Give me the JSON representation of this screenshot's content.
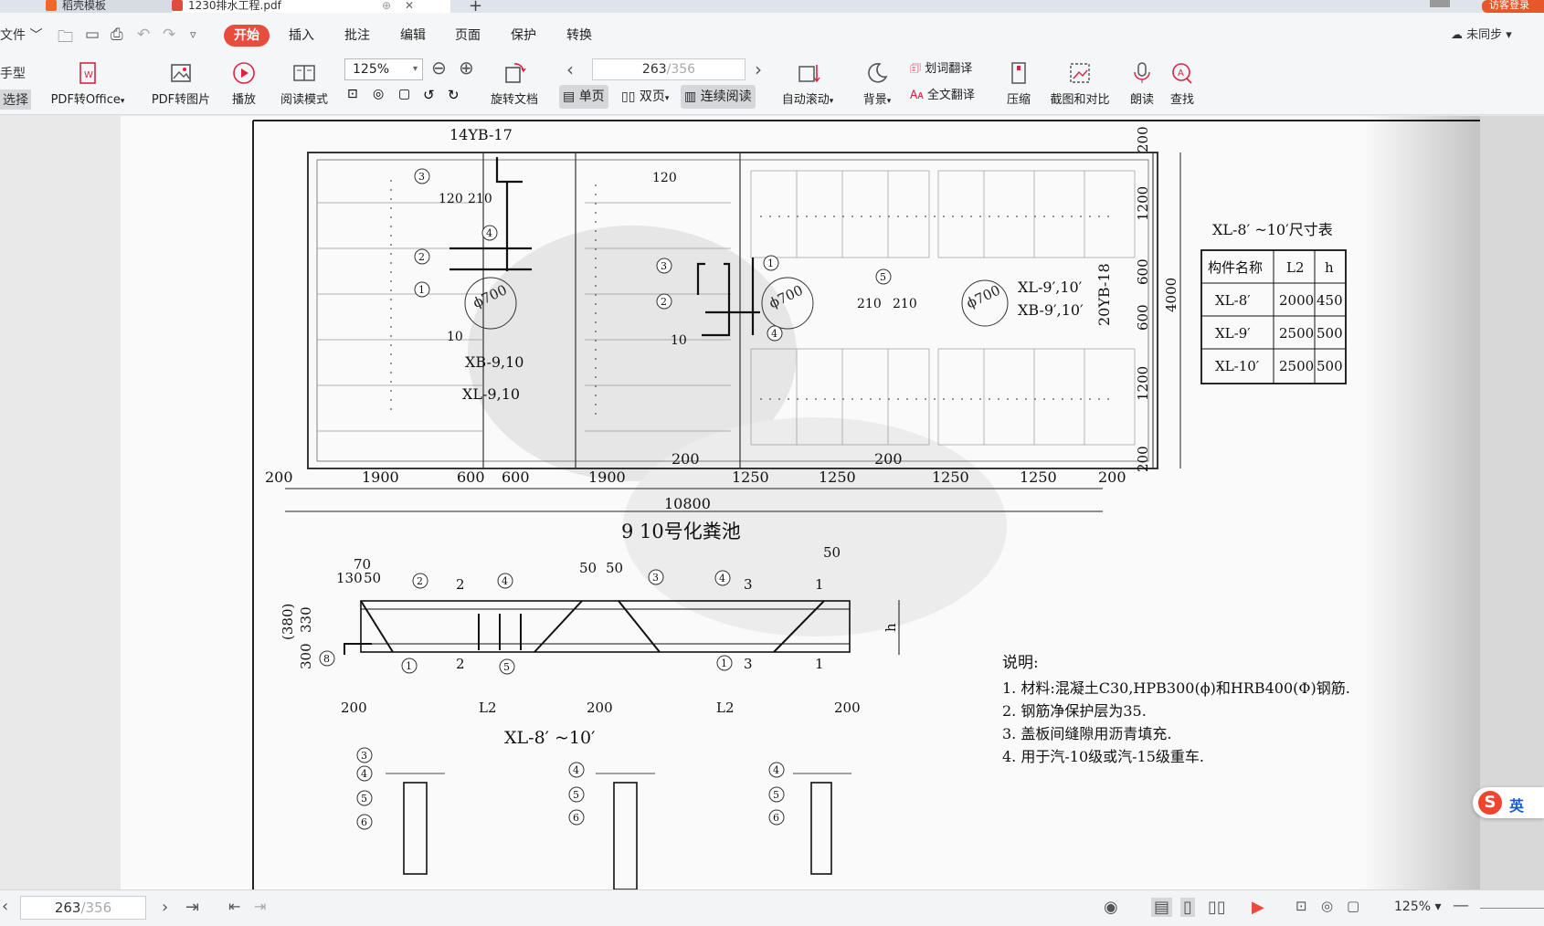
{
  "tabs": {
    "tab1": "稻壳模板",
    "tab2": "1230排水工程.pdf",
    "login": "访客登录"
  },
  "menu": {
    "file": "文件",
    "items": [
      "开始",
      "插入",
      "批注",
      "编辑",
      "页面",
      "保护",
      "转换"
    ],
    "sync": "未同步"
  },
  "toolbar": {
    "left_top": "手型",
    "left_bottom": "选择",
    "pdf_office": "PDF转Office",
    "pdf_image": "PDF转图片",
    "play": "播放",
    "read_mode": "阅读模式",
    "zoom": "125%",
    "rotate": "旋转文档",
    "page_current": "263",
    "page_total": "/356",
    "single": "单页",
    "double": "双页",
    "continuous": "连续阅读",
    "autoscroll": "自动滚动",
    "background": "背景",
    "word_translate": "划词翻译",
    "full_translate": "全文翻译",
    "compress": "压缩",
    "screenshot": "截图和对比",
    "read_aloud": "朗读",
    "find": "查找"
  },
  "drawing": {
    "top_label": "14YB-17",
    "side_label": "20YB-18",
    "table_title": "XL-8′ ~10′尺寸表",
    "table_head": [
      "构件名称",
      "L2",
      "h"
    ],
    "table_rows": [
      [
        "XL-8′",
        "2000",
        "450"
      ],
      [
        "XL-9′",
        "2500",
        "500"
      ],
      [
        "XL-10′",
        "2500",
        "500"
      ]
    ],
    "phi_left": "ϕ700",
    "phi_mid": "ϕ700",
    "phi_right": "ϕ700",
    "xb_left": "XB-9,10",
    "xl_left": "XL-9,10",
    "xl_right": "XL-9′,10′",
    "xb_right": "XB-9′,10′",
    "dims_bottom": [
      "200",
      "1900",
      "600",
      "600",
      "1900",
      "1250",
      "1250",
      "1250",
      "1250",
      "200"
    ],
    "dims_mid": [
      "200",
      "200"
    ],
    "total": "10800",
    "title": "9 10号化粪池",
    "dims_right": [
      "200",
      "1200",
      "600",
      "600",
      "1200",
      "200"
    ],
    "total_right": "4000",
    "nums_small": [
      "120",
      "210",
      "120",
      "210",
      "210",
      "10",
      "10"
    ],
    "beam_title": "XL-8′ ~10′",
    "beam_dims_top": [
      "70",
      "130",
      "50",
      "50",
      "50",
      "50"
    ],
    "beam_dims_left": [
      "(380)",
      "330",
      "300"
    ],
    "beam_dims_bottom": [
      "200",
      "L2",
      "200",
      "L2",
      "200"
    ],
    "beam_h": "h",
    "notes_title": "说明:",
    "notes": [
      "1.  材料:混凝土C30,HPB300(ϕ)和HRB400(Φ)钢筋.",
      "2.  钢筋净保护层为35.",
      "3.  盖板间缝隙用沥青填充.",
      "4.  用于汽-10级或汽-15级重车."
    ],
    "circle_nums": [
      "3",
      "2",
      "1",
      "4",
      "3",
      "2",
      "1",
      "4",
      "5",
      "2",
      "4",
      "3",
      "4",
      "8",
      "1",
      "5",
      "1",
      "3",
      "4",
      "5",
      "6",
      "4",
      "5",
      "6",
      "4",
      "5",
      "6"
    ],
    "section_marks": [
      "2",
      "2",
      "3",
      "3",
      "1",
      "1"
    ]
  },
  "status": {
    "page_current": "263",
    "page_total": "/356",
    "zoom": "125%"
  },
  "ime": {
    "lang": "英"
  }
}
